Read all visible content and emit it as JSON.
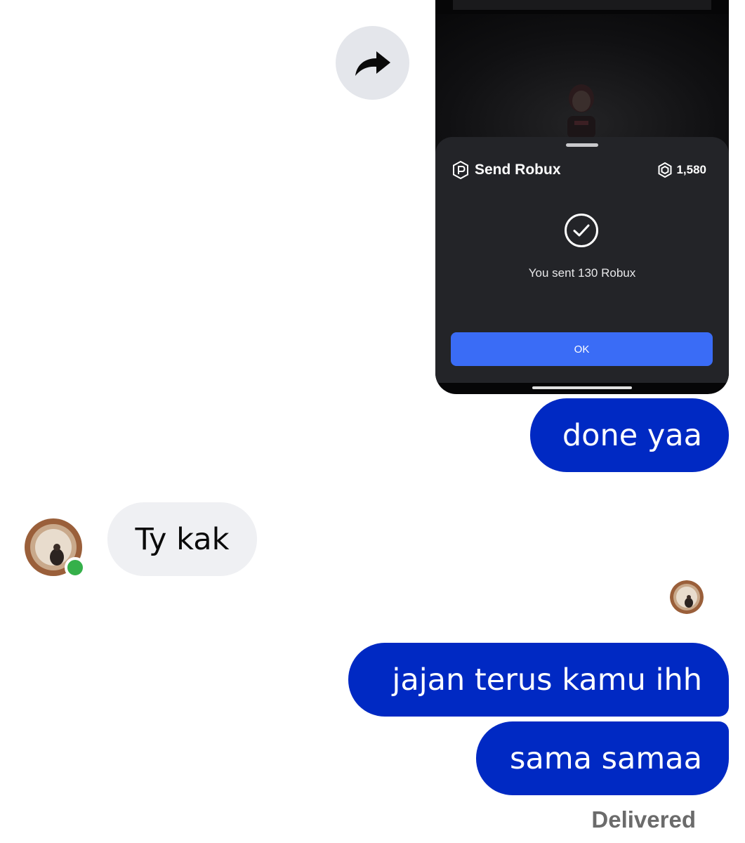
{
  "forward": {
    "icon": "share-arrow-icon"
  },
  "shared_screenshot": {
    "sheet_title": "Send Robux",
    "balance": "1,580",
    "status_text": "You sent 130 Robux",
    "ok_label": "OK",
    "colors": {
      "sheet_bg": "#232428",
      "button": "#3a6cf6"
    }
  },
  "messages": [
    {
      "direction": "outgoing",
      "text": "done yaa"
    },
    {
      "direction": "incoming",
      "text": "Ty kak"
    },
    {
      "direction": "outgoing",
      "text": "jajan terus kamu ihh"
    },
    {
      "direction": "outgoing",
      "text": "sama samaa"
    }
  ],
  "contact": {
    "online": true,
    "status_color": "#35b04a"
  },
  "status": {
    "delivered_label": "Delivered"
  },
  "colors": {
    "outgoing_bubble": "#0029c3",
    "incoming_bubble": "#eff0f3"
  }
}
